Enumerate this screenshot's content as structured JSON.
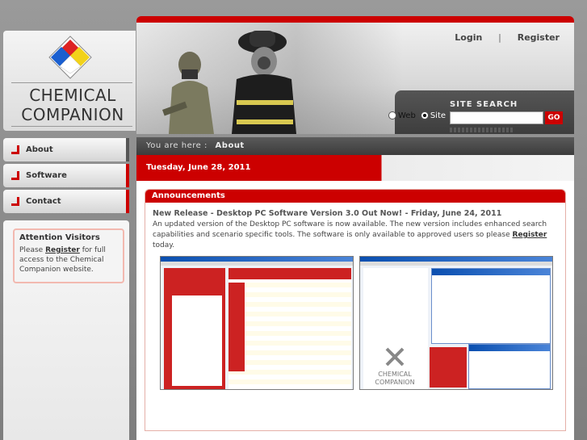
{
  "logo": {
    "line1": "CHEMICAL",
    "line2": "COMPANION"
  },
  "header": {
    "login": "Login",
    "separator": "|",
    "register": "Register"
  },
  "search": {
    "label": "SITE SEARCH",
    "option_web": "Web",
    "option_site": "Site",
    "selected": "Site",
    "go": "GO",
    "value": ""
  },
  "nav": {
    "items": [
      {
        "label": "About"
      },
      {
        "label": "Software"
      },
      {
        "label": "Contact"
      }
    ]
  },
  "attention": {
    "title": "Attention Visitors",
    "text_before": "Please ",
    "link": "Register",
    "text_after": " for full access to the Chemical Companion website."
  },
  "breadcrumb": {
    "prefix": "You are here :",
    "current": "About"
  },
  "date": "Tuesday, June 28, 2011",
  "announcements": {
    "heading": "Announcements",
    "release_title": "New Release - Desktop PC Software Version 3.0 Out Now! - Friday, June 24, 2011",
    "body_before": "An updated version of the Desktop PC software is now available.  The new version includes enhanced search capabilities and scenario specific tools.  The software is only available to approved users so please ",
    "body_link": "Register",
    "body_after": " today.",
    "screenshot2_logo_line1": "CHEMICAL",
    "screenshot2_logo_line2": "COMPANION"
  },
  "colors": {
    "accent": "#cc0000",
    "dark": "#3c3c3c"
  }
}
